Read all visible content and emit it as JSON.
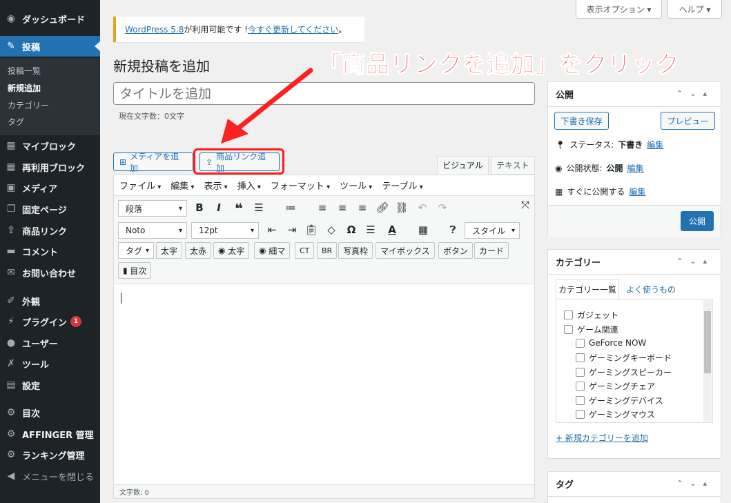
{
  "sidebar": {
    "items": [
      {
        "label": "ダッシュボード",
        "icon": "dashboard-icon",
        "glyph": "◉"
      },
      {
        "label": "投稿",
        "icon": "pin-icon",
        "glyph": "✎"
      },
      {
        "label": "マイブロック",
        "icon": "blocks-icon",
        "glyph": "▦"
      },
      {
        "label": "再利用ブロック",
        "icon": "blocks-icon",
        "glyph": "▦"
      },
      {
        "label": "メディア",
        "icon": "media-icon",
        "glyph": "▣"
      },
      {
        "label": "固定ページ",
        "icon": "pages-icon",
        "glyph": "❐"
      },
      {
        "label": "商品リンク",
        "icon": "share-icon",
        "glyph": "⇪"
      },
      {
        "label": "コメント",
        "icon": "comment-icon",
        "glyph": "▬"
      },
      {
        "label": "お問い合わせ",
        "icon": "mail-icon",
        "glyph": "✉"
      },
      {
        "label": "外観",
        "icon": "brush-icon",
        "glyph": "✐"
      },
      {
        "label": "プラグイン",
        "icon": "plugin-icon",
        "glyph": "⚡",
        "badge": "1"
      },
      {
        "label": "ユーザー",
        "icon": "user-icon",
        "glyph": "●"
      },
      {
        "label": "ツール",
        "icon": "wrench-icon",
        "glyph": "✗"
      },
      {
        "label": "設定",
        "icon": "settings-icon",
        "glyph": "▤"
      },
      {
        "label": "目次",
        "icon": "gear-icon",
        "glyph": "⚙"
      },
      {
        "label": "AFFINGER 管理",
        "icon": "gear-icon",
        "glyph": "⚙"
      },
      {
        "label": "ランキング管理",
        "icon": "gear-icon",
        "glyph": "⚙"
      },
      {
        "label": "メニューを閉じる",
        "icon": "collapse-icon",
        "glyph": "◀"
      }
    ],
    "submenu": [
      "投稿一覧",
      "新規追加",
      "カテゴリー",
      "タグ"
    ]
  },
  "top": {
    "screen_options": "表示オプション ▾",
    "help": "ヘルプ ▾"
  },
  "notice": {
    "link1": "WordPress 5.8",
    "text": " が利用可能です ! ",
    "link2": "今すぐ更新してください",
    "end": "。"
  },
  "page_title": "新規投稿を追加",
  "title_placeholder": "タイトルを追加",
  "char_count": "現在文字数：0文字",
  "annotation": "「商品リンクを追加」をクリック",
  "editor": {
    "add_media": "メディアを追加",
    "add_product_link": "商品リンク追加",
    "tab_visual": "ビジュアル",
    "tab_text": "テキスト",
    "menus": [
      "ファイル",
      "編集",
      "表示",
      "挿入",
      "フォーマット",
      "ツール",
      "テーブル"
    ],
    "format_select": "段落",
    "font_select": "Noto",
    "size_select": "12pt",
    "style_select": "スタイル",
    "tag_select": "タグ",
    "quicktags": [
      "太字",
      "太赤",
      "太字",
      "細マ",
      "CT",
      "BR",
      "写真枠",
      "マイボックス",
      "ボタン",
      "カード"
    ],
    "toc_btn": "目次",
    "word_count": "文字数: 0"
  },
  "publish": {
    "title": "公開",
    "save_draft": "下書き保存",
    "preview": "プレビュー",
    "status_label": "ステータス: ",
    "status_value": "下書き",
    "visibility_label": "公開状態: ",
    "visibility_value": "公開",
    "schedule_label": "すぐに公開する",
    "edit": "編集",
    "publish_btn": "公開"
  },
  "categories": {
    "title": "カテゴリー",
    "tab_all": "カテゴリー一覧",
    "tab_popular": "よく使うもの",
    "items": [
      "ガジェット",
      "ゲーム関連",
      "GeForce NOW",
      "ゲーミングキーボード",
      "ゲーミングスピーカー",
      "ゲーミングチェア",
      "ゲーミングデバイス",
      "ゲーミングマウス"
    ],
    "add_new": "+ 新規カテゴリーを追加"
  },
  "tags": {
    "title": "タグ"
  }
}
